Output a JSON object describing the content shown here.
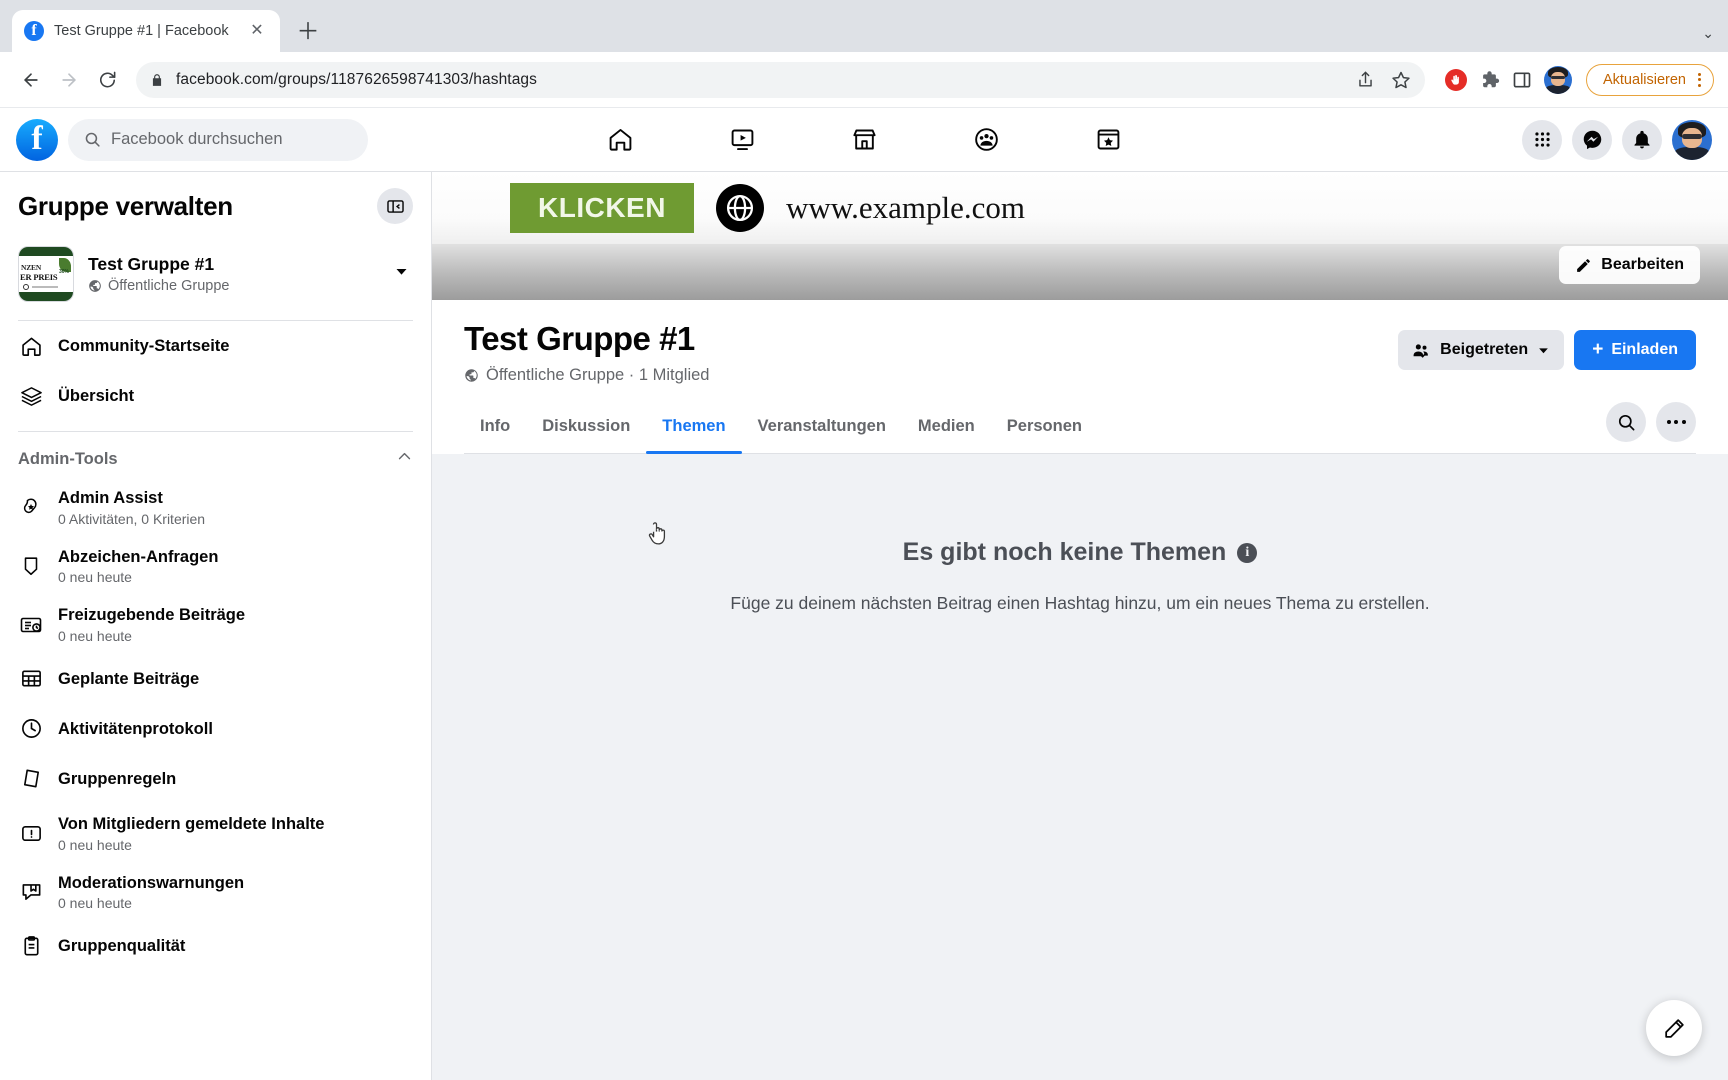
{
  "browser": {
    "tab": {
      "title": "Test Gruppe #1 | Facebook",
      "close_label": "✕"
    },
    "new_tab_label": "＋",
    "tabstrip_menu_label": "⌄",
    "url": "facebook.com/groups/1187626598741303/hashtags",
    "update_button": "Aktualisieren",
    "icons": {
      "back": "back-arrow-icon",
      "forward": "forward-arrow-icon",
      "reload": "reload-icon",
      "lock": "lock-icon",
      "share": "share-icon",
      "bookmark": "star-icon",
      "adblock": "adblock-stop-hand-icon",
      "extensions": "puzzle-piece-icon",
      "sidepanel": "side-panel-icon",
      "profile": "browser-profile-avatar"
    }
  },
  "fb_header": {
    "logo": "facebook-logo",
    "search_placeholder": "Facebook durchsuchen",
    "nav": [
      {
        "name": "home",
        "icon": "home-icon"
      },
      {
        "name": "watch",
        "icon": "video-play-icon"
      },
      {
        "name": "marketplace",
        "icon": "storefront-icon"
      },
      {
        "name": "groups",
        "icon": "groups-icon"
      },
      {
        "name": "gaming",
        "icon": "gaming-badge-icon"
      }
    ],
    "right": [
      {
        "name": "menu",
        "icon": "grid-menu-icon"
      },
      {
        "name": "messenger",
        "icon": "messenger-icon"
      },
      {
        "name": "notifications",
        "icon": "bell-icon"
      },
      {
        "name": "account",
        "icon": "account-avatar"
      }
    ]
  },
  "sidebar": {
    "title": "Gruppe verwalten",
    "collapse_icon": "collapse-sidebar-icon",
    "group": {
      "name": "Test Gruppe #1",
      "privacy": "Öffentliche Gruppe",
      "thumb_line1": "NZEN",
      "thumb_line2": "ER PREIS",
      "thumb_badge": "30%"
    },
    "nav": [
      {
        "label": "Community-Startseite",
        "icon": "home-icon"
      },
      {
        "label": "Übersicht",
        "icon": "layers-icon"
      }
    ],
    "section": {
      "label": "Admin-Tools",
      "chevron": "chevron-up-icon"
    },
    "items": [
      {
        "label": "Admin Assist",
        "sub": "0 Aktivitäten, 0 Kriterien",
        "icon": "admin-assist-icon"
      },
      {
        "label": "Abzeichen-Anfragen",
        "sub": "0 neu heute",
        "icon": "badge-icon"
      },
      {
        "label": "Freizugebende Beiträge",
        "sub": "0 neu heute",
        "icon": "pending-posts-icon"
      },
      {
        "label": "Geplante Beiträge",
        "sub": "",
        "icon": "calendar-grid-icon"
      },
      {
        "label": "Aktivitätenprotokoll",
        "sub": "",
        "icon": "clock-icon"
      },
      {
        "label": "Gruppenregeln",
        "sub": "",
        "icon": "rules-book-icon"
      },
      {
        "label": "Von Mitgliedern gemeldete Inhalte",
        "sub": "0 neu heute",
        "icon": "warning-exclamation-icon"
      },
      {
        "label": "Moderationswarnungen",
        "sub": "0 neu heute",
        "icon": "moderation-alert-icon"
      },
      {
        "label": "Gruppenqualität",
        "sub": "",
        "icon": "clipboard-icon"
      }
    ]
  },
  "cover": {
    "klicken_label": "KLICKEN",
    "url_text": "www.example.com",
    "globe_icon": "globe-icon",
    "edit_label": "Bearbeiten",
    "edit_icon": "pencil-icon"
  },
  "group_header": {
    "title": "Test Gruppe #1",
    "meta": "Öffentliche Gruppe · 1 Mitglied",
    "privacy_icon": "globe-small-icon",
    "joined_label": "Beigetreten",
    "joined_icon": "members-check-icon",
    "joined_caret": "chevron-down-icon",
    "invite_label": "Einladen",
    "invite_plus": "+"
  },
  "tabs": [
    {
      "label": "Info",
      "active": false
    },
    {
      "label": "Diskussion",
      "active": false
    },
    {
      "label": "Themen",
      "active": true
    },
    {
      "label": "Veranstaltungen",
      "active": false
    },
    {
      "label": "Medien",
      "active": false
    },
    {
      "label": "Personen",
      "active": false
    }
  ],
  "tabs_actions": {
    "search_icon": "search-icon",
    "more_icon": "more-horizontal-icon"
  },
  "empty_state": {
    "title": "Es gibt noch keine Themen",
    "info_icon": "info-icon",
    "info_glyph": "i",
    "subtitle": "Füge zu deinem nächsten Beitrag einen Hashtag hinzu, um ein neues Thema zu erstellen."
  },
  "fab": {
    "icon": "compose-pencil-icon"
  },
  "colors": {
    "brand_blue": "#1877f2",
    "surface": "#ffffff",
    "page_bg": "#f0f2f5",
    "muted_text": "#65676b",
    "update_orange": "#c26401",
    "cover_green": "#6f9b32"
  }
}
